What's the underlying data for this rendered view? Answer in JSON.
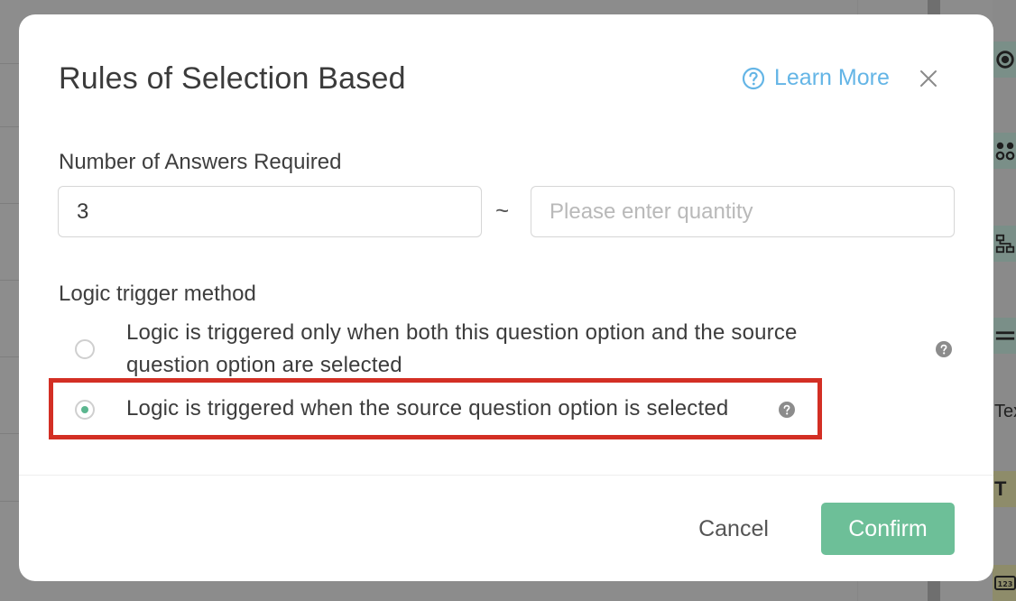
{
  "dialog": {
    "title": "Rules of Selection Based",
    "learn_more": "Learn More",
    "answers_label": "Number of Answers Required",
    "min_value": "3",
    "separator": "~",
    "max_placeholder": "Please enter quantity",
    "trigger_label": "Logic trigger method",
    "options": [
      {
        "label_line1": "Logic is triggered only when both this question option and the source",
        "label_line2": "question option are selected",
        "selected": false
      },
      {
        "label": "Logic is triggered when the source question option is selected",
        "selected": true
      }
    ],
    "cancel": "Cancel",
    "confirm": "Confirm"
  },
  "background": {
    "right_panel_text": [
      "Tex",
      "T"
    ]
  },
  "colors": {
    "accent_green": "#6dbf98",
    "link_blue": "#64b5e6",
    "highlight_red": "#d32f24"
  },
  "icons": {
    "learn_more": "question-circle-icon",
    "close": "close-icon",
    "option_help": "question-circle-filled-icon"
  }
}
